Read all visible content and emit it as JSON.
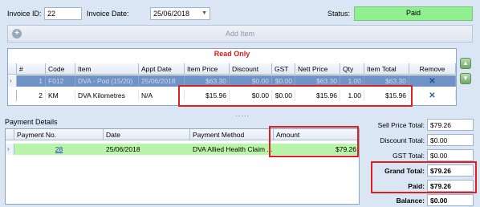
{
  "header": {
    "invoice_id_label": "Invoice ID:",
    "invoice_id_value": "22",
    "invoice_date_label": "Invoice Date:",
    "invoice_date_value": "25/06/2018",
    "status_label": "Status:",
    "status_value": "Paid"
  },
  "toolbar": {
    "add_item_label": "Add Item"
  },
  "items_grid": {
    "banner": "Read Only",
    "columns": [
      "#",
      "Code",
      "Item",
      "Appt Date",
      "Item Price",
      "Discount",
      "GST",
      "Nett Price",
      "Qty",
      "Item Total",
      "Remove"
    ],
    "rows": [
      {
        "num": "1",
        "code": "F012",
        "item": "DVA - Pod (15/20)",
        "appt_date": "25/06/2018",
        "item_price": "$63.30",
        "discount": "$0.00",
        "gst": "$0.00",
        "nett_price": "$63.30",
        "qty": "1.00",
        "item_total": "$63.30",
        "remove": "✕"
      },
      {
        "num": "2",
        "code": "KM",
        "item": "DVA Kilometres",
        "appt_date": "N/A",
        "item_price": "$15.96",
        "discount": "$0.00",
        "gst": "$0.00",
        "nett_price": "$15.96",
        "qty": "1.00",
        "item_total": "$15.96",
        "remove": "✕"
      }
    ]
  },
  "payments": {
    "title": "Payment Details",
    "columns": [
      "Payment No.",
      "Date",
      "Payment Method",
      "Amount"
    ],
    "rows": [
      {
        "payment_no": "28",
        "date": "25/06/2018",
        "method": "DVA Allied Health Claim ...",
        "amount": "$79.26"
      }
    ]
  },
  "totals": {
    "sell_price_label": "Sell Price Total:",
    "sell_price_value": "$79.26",
    "discount_label": "Discount Total:",
    "discount_value": "$0.00",
    "gst_label": "GST Total:",
    "gst_value": "$0.00",
    "grand_label": "Grand Total:",
    "grand_value": "$79.26",
    "paid_label": "Paid:",
    "paid_value": "$79.26",
    "balance_label": "Balance:",
    "balance_value": "$0.00"
  },
  "colors": {
    "status_green": "#8ff08f",
    "selected_row": "#6f93c7",
    "payment_row": "#b9f5a8",
    "highlight_red": "#e02020",
    "readonly_red": "#e01818"
  },
  "icons": {
    "add": "plus-circle-icon",
    "remove": "close-icon",
    "move_up": "arrow-up-icon",
    "move_down": "arrow-down-icon"
  }
}
